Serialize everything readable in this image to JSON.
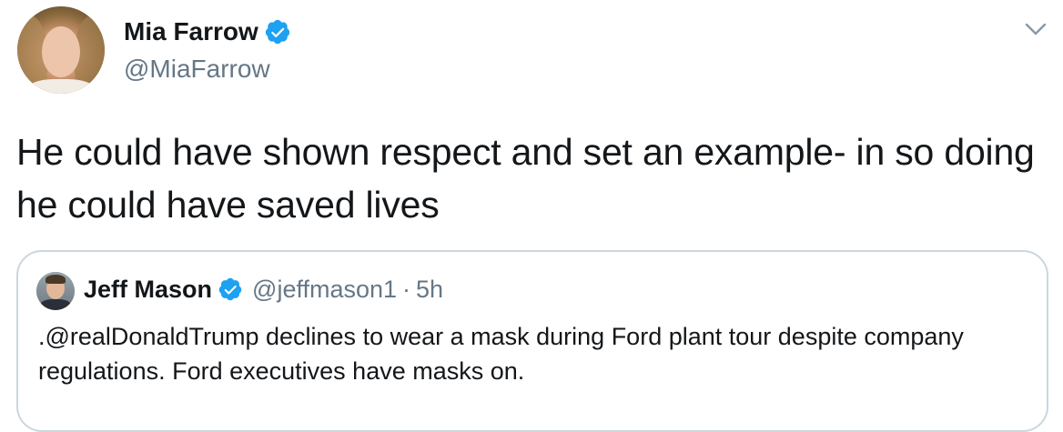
{
  "tweet": {
    "author": {
      "name": "Mia Farrow",
      "handle": "@MiaFarrow",
      "verified": true
    },
    "text": "He could have shown respect and set an example- in so doing he could have saved lives",
    "menu_icon": "chevron-down-icon"
  },
  "quoted_tweet": {
    "author": {
      "name": "Jeff Mason",
      "handle": "@jeffmason1",
      "verified": true
    },
    "separator": "·",
    "time": "5h",
    "text": ".@realDonaldTrump declines to wear a mask during Ford plant tour despite company regulations. Ford executives have masks on."
  },
  "colors": {
    "verified_blue": "#1da1f2",
    "secondary_text": "#657786",
    "border": "#ccd6dd",
    "primary_text": "#14171a"
  }
}
